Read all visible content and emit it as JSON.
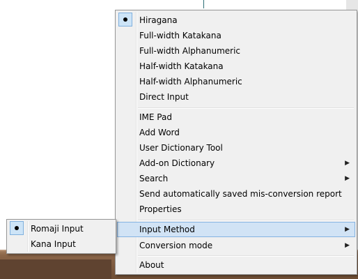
{
  "main_menu": {
    "group1": [
      {
        "label": "Hiragana",
        "checked": true
      },
      {
        "label": "Full-width Katakana"
      },
      {
        "label": "Full-width Alphanumeric"
      },
      {
        "label": "Half-width Katakana"
      },
      {
        "label": "Half-width Alphanumeric"
      },
      {
        "label": "Direct Input"
      }
    ],
    "group2": [
      {
        "label": "IME Pad"
      },
      {
        "label": "Add Word"
      },
      {
        "label": "User Dictionary Tool"
      },
      {
        "label": "Add-on Dictionary",
        "submenu": true
      },
      {
        "label": "Search",
        "submenu": true
      },
      {
        "label": "Send automatically saved mis-conversion report"
      },
      {
        "label": "Properties"
      }
    ],
    "group3": [
      {
        "label": "Input Method",
        "submenu": true,
        "highlighted": true
      },
      {
        "label": "Conversion mode",
        "submenu": true
      }
    ],
    "group4": [
      {
        "label": "About"
      }
    ]
  },
  "sub_menu": {
    "items": [
      {
        "label": "Romaji Input",
        "checked": true
      },
      {
        "label": "Kana Input"
      }
    ]
  },
  "icons": {
    "submenu_arrow": "▶",
    "check_dot": "radio-dot-icon"
  },
  "colors": {
    "menu_bg": "#f0f0f0",
    "highlight_bg": "#d1e3f5",
    "highlight_border": "#84b3e2"
  }
}
